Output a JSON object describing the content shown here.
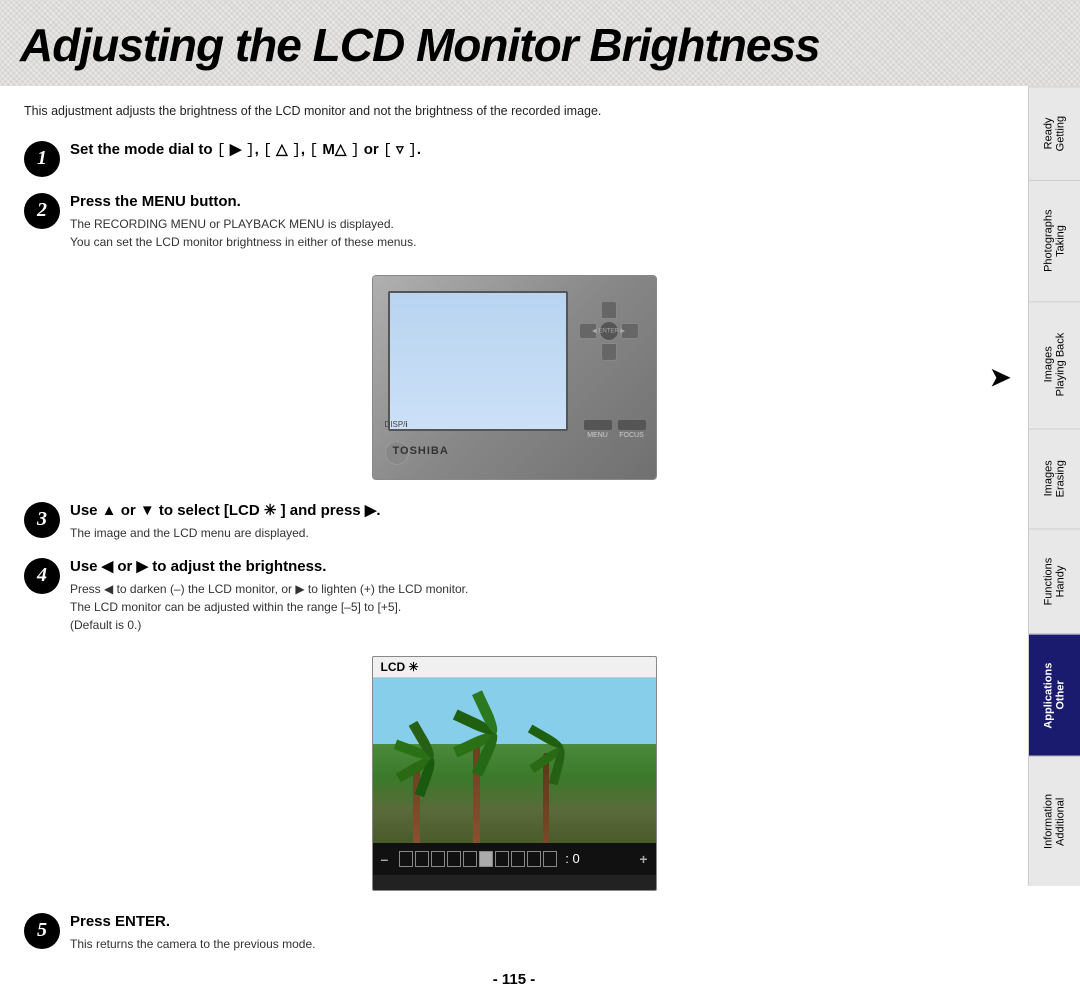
{
  "page": {
    "title": "Adjusting the LCD Monitor Brightness",
    "intro": "This adjustment adjusts the brightness of the LCD monitor and not the brightness of the recorded image.",
    "page_number": "- 115 -"
  },
  "steps": [
    {
      "number": "1",
      "title": "Set the mode dial to [ ▶ ], [ ▲ ], [ M▲ ] or [ ▼ ].",
      "desc": ""
    },
    {
      "number": "2",
      "title": "Press the MENU button.",
      "desc": "The RECORDING MENU or PLAYBACK MENU is displayed.\nYou can set the LCD monitor brightness in either of these menus."
    },
    {
      "number": "3",
      "title": "Use ▲ or ▼ to select [LCD ✳ ] and press ▶.",
      "desc": "The image and the LCD menu are displayed."
    },
    {
      "number": "4",
      "title": "Use ◀ or ▶ to adjust the brightness.",
      "desc": "Press ◀ to darken (–) the LCD monitor, or ▶ to lighten (+) the LCD monitor.\nThe LCD monitor can be adjusted within the range [–5] to [+5].\n(Default is 0.)"
    },
    {
      "number": "5",
      "title": "Press ENTER.",
      "desc": "This returns the camera to the previous mode."
    }
  ],
  "camera": {
    "brand": "TOSHIBA",
    "enter_label": "◀ ENTER ▶",
    "disp_label": "DISP/i",
    "menu_label": "MENU",
    "focus_label": "FOCUS"
  },
  "lcd": {
    "header": "LCD ✳",
    "minus": "–",
    "plus": "+",
    "value": "0",
    "bar_count": 10,
    "filled_count": 5
  },
  "sidebar": {
    "items": [
      {
        "label": "Getting Ready",
        "active": false
      },
      {
        "label": "Taking Photographs",
        "active": false
      },
      {
        "label": "Playing Back Images",
        "active": false
      },
      {
        "label": "Erasing Images",
        "active": false
      },
      {
        "label": "Handy Functions",
        "active": false
      },
      {
        "label": "Other Applications",
        "active": true,
        "highlighted": true
      },
      {
        "label": "Additional Information",
        "active": false
      }
    ]
  }
}
